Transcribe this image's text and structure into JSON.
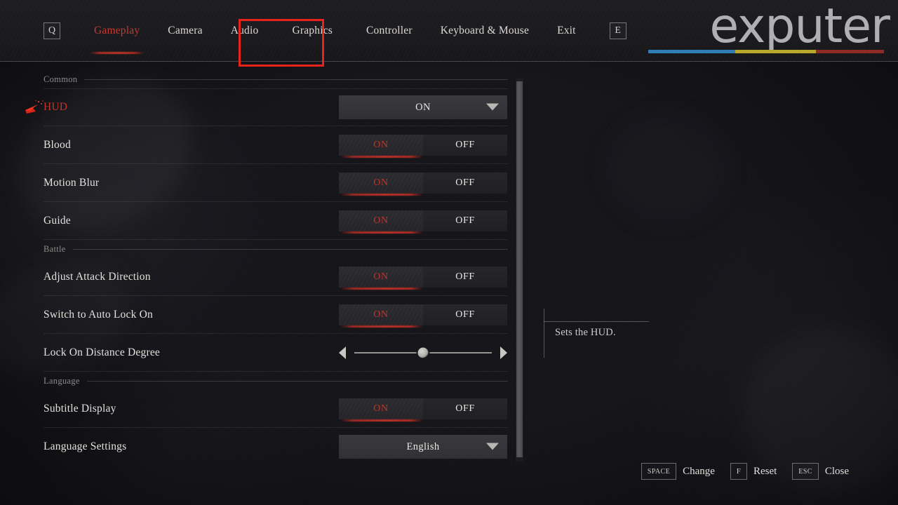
{
  "header": {
    "left_key": "Q",
    "right_key": "E",
    "tabs": [
      {
        "label": "Gameplay",
        "state": "active"
      },
      {
        "label": "Camera",
        "state": "normal"
      },
      {
        "label": "Audio",
        "state": "normal"
      },
      {
        "label": "Graphics",
        "state": "highlighted"
      },
      {
        "label": "Controller",
        "state": "normal"
      },
      {
        "label": "Keyboard & Mouse",
        "state": "normal"
      },
      {
        "label": "Exit",
        "state": "normal"
      }
    ]
  },
  "logo": {
    "text": "exputer",
    "bar_colors": [
      "#2f7fb5",
      "#b8a72b",
      "#8e2b26"
    ]
  },
  "sections": [
    {
      "title": "Common"
    },
    {
      "title": "Battle"
    },
    {
      "title": "Language"
    }
  ],
  "settings": {
    "common": [
      {
        "label": "HUD",
        "control": "dropdown",
        "value": "ON",
        "selected": true,
        "cursor_icon": "red-cursor-icon"
      },
      {
        "label": "Blood",
        "control": "toggle",
        "on_label": "ON",
        "off_label": "OFF",
        "value": "ON"
      },
      {
        "label": "Motion Blur",
        "control": "toggle",
        "on_label": "ON",
        "off_label": "OFF",
        "value": "ON"
      },
      {
        "label": "Guide",
        "control": "toggle",
        "on_label": "ON",
        "off_label": "OFF",
        "value": "ON"
      }
    ],
    "battle": [
      {
        "label": "Adjust Attack Direction",
        "control": "toggle",
        "on_label": "ON",
        "off_label": "OFF",
        "value": "ON"
      },
      {
        "label": "Switch to Auto Lock On",
        "control": "toggle",
        "on_label": "ON",
        "off_label": "OFF",
        "value": "ON"
      },
      {
        "label": "Lock On Distance Degree",
        "control": "slider",
        "value": "5",
        "min": 0,
        "max": 10,
        "percent": 50
      }
    ],
    "language": [
      {
        "label": "Subtitle Display",
        "control": "toggle",
        "on_label": "ON",
        "off_label": "OFF",
        "value": "ON"
      },
      {
        "label": "Language Settings",
        "control": "dropdown",
        "value": "English"
      }
    ]
  },
  "tooltip": {
    "text": "Sets the HUD."
  },
  "hints": [
    {
      "key": "SPACE",
      "label": "Change"
    },
    {
      "key": "F",
      "label": "Reset"
    },
    {
      "key": "ESC",
      "label": "Close"
    }
  ],
  "colors": {
    "accent_red": "#c4342c",
    "annotation_red": "#e8231c",
    "background": "#15151a",
    "text": "#e4e1dc",
    "muted_text": "#8e8c89"
  }
}
